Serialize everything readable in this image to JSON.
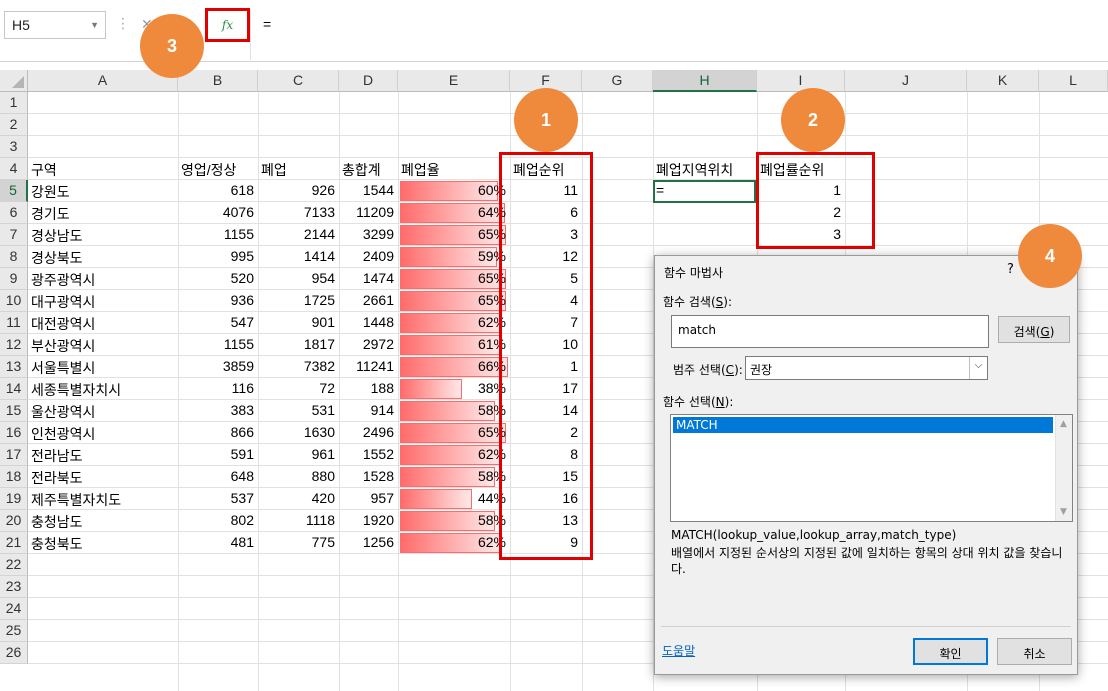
{
  "name_box": "H5",
  "formula": "=",
  "fx_label": "fx",
  "columns": [
    "A",
    "B",
    "C",
    "D",
    "E",
    "F",
    "G",
    "H",
    "I",
    "J",
    "K",
    "L"
  ],
  "rows": [
    "1",
    "2",
    "3",
    "4",
    "5",
    "6",
    "7",
    "8",
    "9",
    "10",
    "11",
    "12",
    "13",
    "14",
    "15",
    "16",
    "17",
    "18",
    "19",
    "20",
    "21",
    "22",
    "23",
    "24",
    "25",
    "26"
  ],
  "headers": {
    "region": "구역",
    "open": "영업/정상",
    "closed": "폐업",
    "total": "총합계",
    "rate": "폐업율",
    "rank": "폐업순위",
    "h_header": "폐업지역위치",
    "i_header": "폐업률순위"
  },
  "table": [
    {
      "region": "강원도",
      "open": "618",
      "closed": "926",
      "total": "1544",
      "rate_text": "60%",
      "rate": 0.6,
      "rank": "11"
    },
    {
      "region": "경기도",
      "open": "4076",
      "closed": "7133",
      "total": "11209",
      "rate_text": "64%",
      "rate": 0.64,
      "rank": "6"
    },
    {
      "region": "경상남도",
      "open": "1155",
      "closed": "2144",
      "total": "3299",
      "rate_text": "65%",
      "rate": 0.65,
      "rank": "3"
    },
    {
      "region": "경상북도",
      "open": "995",
      "closed": "1414",
      "total": "2409",
      "rate_text": "59%",
      "rate": 0.59,
      "rank": "12"
    },
    {
      "region": "광주광역시",
      "open": "520",
      "closed": "954",
      "total": "1474",
      "rate_text": "65%",
      "rate": 0.65,
      "rank": "5"
    },
    {
      "region": "대구광역시",
      "open": "936",
      "closed": "1725",
      "total": "2661",
      "rate_text": "65%",
      "rate": 0.65,
      "rank": "4"
    },
    {
      "region": "대전광역시",
      "open": "547",
      "closed": "901",
      "total": "1448",
      "rate_text": "62%",
      "rate": 0.62,
      "rank": "7"
    },
    {
      "region": "부산광역시",
      "open": "1155",
      "closed": "1817",
      "total": "2972",
      "rate_text": "61%",
      "rate": 0.61,
      "rank": "10"
    },
    {
      "region": "서울특별시",
      "open": "3859",
      "closed": "7382",
      "total": "11241",
      "rate_text": "66%",
      "rate": 0.66,
      "rank": "1"
    },
    {
      "region": "세종특별자치시",
      "open": "116",
      "closed": "72",
      "total": "188",
      "rate_text": "38%",
      "rate": 0.38,
      "rank": "17"
    },
    {
      "region": "울산광역시",
      "open": "383",
      "closed": "531",
      "total": "914",
      "rate_text": "58%",
      "rate": 0.58,
      "rank": "14"
    },
    {
      "region": "인천광역시",
      "open": "866",
      "closed": "1630",
      "total": "2496",
      "rate_text": "65%",
      "rate": 0.65,
      "rank": "2"
    },
    {
      "region": "전라남도",
      "open": "591",
      "closed": "961",
      "total": "1552",
      "rate_text": "62%",
      "rate": 0.62,
      "rank": "8"
    },
    {
      "region": "전라북도",
      "open": "648",
      "closed": "880",
      "total": "1528",
      "rate_text": "58%",
      "rate": 0.58,
      "rank": "15"
    },
    {
      "region": "제주특별자치도",
      "open": "537",
      "closed": "420",
      "total": "957",
      "rate_text": "44%",
      "rate": 0.44,
      "rank": "16"
    },
    {
      "region": "충청남도",
      "open": "802",
      "closed": "1118",
      "total": "1920",
      "rate_text": "58%",
      "rate": 0.58,
      "rank": "13"
    },
    {
      "region": "충청북도",
      "open": "481",
      "closed": "775",
      "total": "1256",
      "rate_text": "62%",
      "rate": 0.62,
      "rank": "9"
    }
  ],
  "h5_value": "=",
  "i_ranks": [
    "1",
    "2",
    "3"
  ],
  "badges": [
    "1",
    "2",
    "3",
    "4"
  ],
  "dialog": {
    "title": "함수 마법사",
    "help": "?",
    "search_label": "함수 검색(",
    "search_key": "S",
    "search_label_end": "):",
    "search_value": "match",
    "search_button": "검색(",
    "search_button_key": "G",
    "search_button_end": ")",
    "category_label": "범주 선택(",
    "category_key": "C",
    "category_label_end": "):",
    "category_value": "권장",
    "function_label": "함수 선택(",
    "function_key": "N",
    "function_label_end": "):",
    "functions": [
      "MATCH"
    ],
    "signature": "MATCH(lookup_value,lookup_array,match_type)",
    "description": "배열에서 지정된 순서상의 지정된 값에 일치하는 항목의 상대 위치 값을 찾습니다.",
    "help_link": "도움말",
    "ok": "확인",
    "cancel": "취소"
  },
  "colors": {
    "accent_green": "#217346",
    "highlight_red": "#e00000",
    "badge_orange": "#ef8a3c",
    "databar_red": "#ff6b6b",
    "selection_blue": "#0078d7"
  }
}
